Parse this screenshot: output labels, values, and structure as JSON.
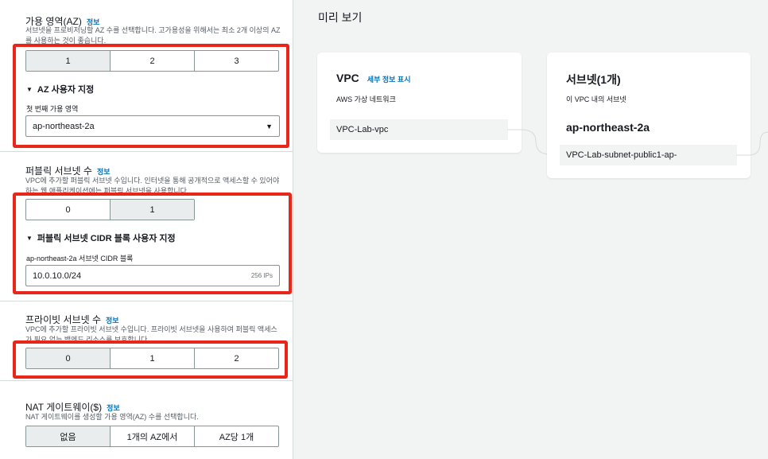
{
  "az_section": {
    "title": "가용 영역(AZ)",
    "info": "정보",
    "description": "서브넷을 프로비저닝할 AZ 수를 선택합니다. 고가용성을 위해서는 최소 2개 이상의 AZ를 사용하는 것이 좋습니다.",
    "options": [
      "1",
      "2",
      "3"
    ],
    "selected": "1",
    "custom_label": "AZ 사용자 지정",
    "first_az_label": "첫 번째 가용 영역",
    "first_az_value": "ap-northeast-2a"
  },
  "public_section": {
    "title": "퍼블릭 서브넷 수",
    "info": "정보",
    "description": "VPC에 추가할 퍼블릭 서브넷 수입니다. 인터넷을 통해 공개적으로 액세스할 수 있어야 하는 웹 애플리케이션에는 퍼블릭 서브넷을 사용합니다.",
    "options": [
      "0",
      "1"
    ],
    "selected": "1",
    "custom_label": "퍼블릭 서브넷 CIDR 블록 사용자 지정",
    "cidr_label": "ap-northeast-2a 서브넷 CIDR 블록",
    "cidr_value": "10.0.10.0/24",
    "cidr_suffix": "256 IPs"
  },
  "private_section": {
    "title": "프라이빗 서브넷 수",
    "info": "정보",
    "description": "VPC에 추가할 프라이빗 서브넷 수입니다. 프라이빗 서브넷을 사용하여 퍼블릭 액세스가 필요 없는 백엔드 리소스를 보호합니다.",
    "options": [
      "0",
      "1",
      "2"
    ],
    "selected": "0"
  },
  "nat_section": {
    "title": "NAT 게이트웨이($)",
    "info": "정보",
    "description": "NAT 게이트웨이를 생성할 가용 영역(AZ) 수를 선택합니다.",
    "options": [
      "없음",
      "1개의 AZ에서",
      "AZ당 1개"
    ],
    "selected": "없음"
  },
  "preview": {
    "title": "미리 보기",
    "vpc_card": {
      "title": "VPC",
      "link": "세부 정보 표시",
      "subtitle": "AWS 가상 네트워크",
      "item": "VPC-Lab-vpc"
    },
    "subnet_card": {
      "title": "서브넷(1개)",
      "subtitle": "이 VPC 내의 서브넷",
      "az": "ap-northeast-2a",
      "item": "VPC-Lab-subnet-public1-ap-"
    }
  },
  "colors": {
    "highlight": "#e8271a",
    "link": "#0073bb",
    "selected_segment": "#eaeded"
  }
}
